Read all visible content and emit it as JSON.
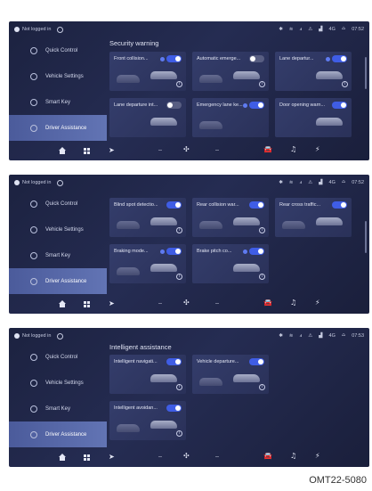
{
  "status": {
    "user_label": "Not logged in",
    "network": "4G",
    "time_1": "07:52",
    "time_2": "07:52",
    "time_3": "07:53"
  },
  "sidebar": {
    "items": [
      {
        "label": "Quick Control",
        "icon": "quick-control-icon"
      },
      {
        "label": "Vehicle Settings",
        "icon": "vehicle-settings-icon"
      },
      {
        "label": "Smart Key",
        "icon": "smart-key-icon"
      },
      {
        "label": "Driver Assistance",
        "icon": "driver-assistance-icon"
      }
    ]
  },
  "screen1": {
    "section_title": "Security warning",
    "cards": [
      {
        "label": "Front collision...",
        "on": true
      },
      {
        "label": "Automatic emerge...",
        "on": false
      },
      {
        "label": "Lane departur...",
        "on": true
      },
      {
        "label": "Lane departure int...",
        "on": false
      },
      {
        "label": "Emergency lane ke...",
        "on": true
      },
      {
        "label": "Door opening warn...",
        "on": true
      }
    ]
  },
  "screen2": {
    "cards": [
      {
        "label": "Blind spot detectio...",
        "on": true
      },
      {
        "label": "Rear collision war...",
        "on": true
      },
      {
        "label": "Rear cross traffic...",
        "on": true
      },
      {
        "label": "Braking mode...",
        "on": true
      },
      {
        "label": "Brake pitch co...",
        "on": true
      }
    ]
  },
  "screen3": {
    "section_title": "Intelligent assistance",
    "cards": [
      {
        "label": "Intelligent navigati...",
        "on": true
      },
      {
        "label": "Vehicle departure...",
        "on": true
      },
      {
        "label": "Intelligent avoidan...",
        "on": true
      }
    ]
  },
  "bottombar": {
    "temp_left": "--",
    "temp_right": "--"
  },
  "caption": "OMT22-5080",
  "colors": {
    "accent": "#3f5de5",
    "active_nav": "#5667a8",
    "screen_bg": "#1f2546"
  }
}
